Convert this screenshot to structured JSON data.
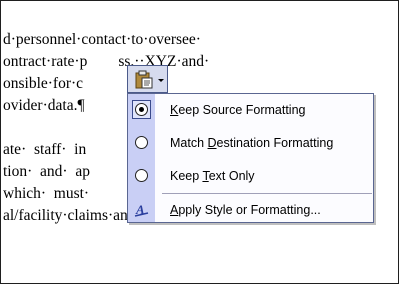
{
  "document": {
    "lines": [
      "d·personnel·contact·to·oversee·",
      "ontract·rate·p        ss.··XYZ·and·",
      "onsible·for·c",
      "ovider·data.¶",
      "",
      "ate·  staff·  in",
      "tion·  and·  ap",
      "which·  must·",
      "al/facility·claims·and·as·needed·"
    ]
  },
  "paste_options": {
    "button_icon": "clipboard-paste-icon",
    "dropdown_icon": "chevron-down-icon",
    "items": [
      {
        "pre": "",
        "key": "K",
        "post": "eep Source Formatting",
        "icon": "radio-checked-icon",
        "selected": true
      },
      {
        "pre": "Match ",
        "key": "D",
        "post": "estination Formatting",
        "icon": "radio-icon",
        "selected": false
      },
      {
        "pre": "Keep ",
        "key": "T",
        "post": "ext Only",
        "icon": "radio-icon",
        "selected": false
      },
      {
        "pre": "",
        "key": "A",
        "post": "pply Style or Formatting...",
        "icon": "style-icon",
        "selected": false
      }
    ]
  }
}
